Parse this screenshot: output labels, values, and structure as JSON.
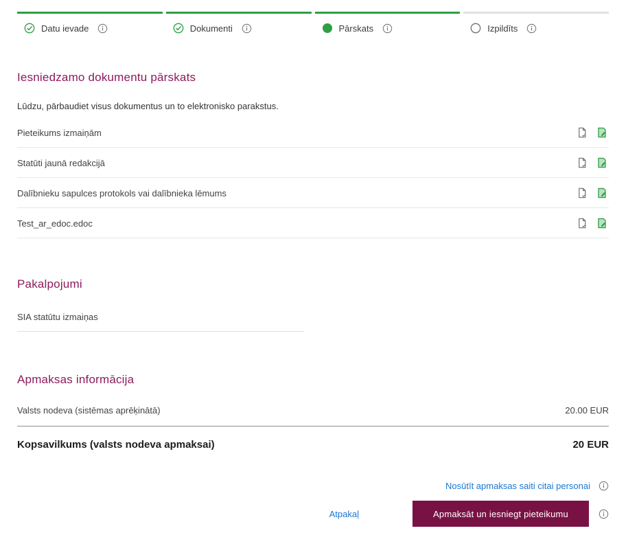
{
  "steps": [
    {
      "label": "Datu ievade",
      "state": "done"
    },
    {
      "label": "Dokumenti",
      "state": "done"
    },
    {
      "label": "Pārskats",
      "state": "active"
    },
    {
      "label": "Izpildīts",
      "state": "pending"
    }
  ],
  "documents": {
    "title": "Iesniedzamo dokumentu pārskats",
    "subtitle": "Lūdzu, pārbaudiet visus dokumentus un to elektronisko parakstus.",
    "items": [
      "Pieteikums izmaiņām",
      "Statūti jaunā redakcijā",
      "Dalībnieku sapulces protokols vai dalībnieka lēmums",
      "Test_ar_edoc.edoc"
    ]
  },
  "services": {
    "title": "Pakalpojumi",
    "items": [
      "SIA statūtu izmaiņas"
    ]
  },
  "payment": {
    "title": "Apmaksas informācija",
    "fee_label": "Valsts nodeva (sistēmas aprēķinātā)",
    "fee_value": "20.00 EUR",
    "summary_label": "Kopsavilkums (valsts nodeva apmaksai)",
    "summary_value": "20 EUR"
  },
  "footer": {
    "send_link_label": "Nosūtīt apmaksas saiti citai personai",
    "back_label": "Atpakaļ",
    "submit_label": "Apmaksāt un iesniegt pieteikumu"
  },
  "icons": {
    "step_done": "check-circle-icon",
    "step_active": "filled-circle-icon",
    "step_pending": "empty-circle-icon",
    "info": "info-icon",
    "document": "document-icon",
    "signed_document": "signed-document-icon"
  },
  "colors": {
    "accent_green": "#2f9e44",
    "heading_magenta": "#8c1b5c",
    "button_burgundy": "#791244",
    "link_blue": "#1976d2",
    "pending_gray": "#e1e1e1"
  }
}
